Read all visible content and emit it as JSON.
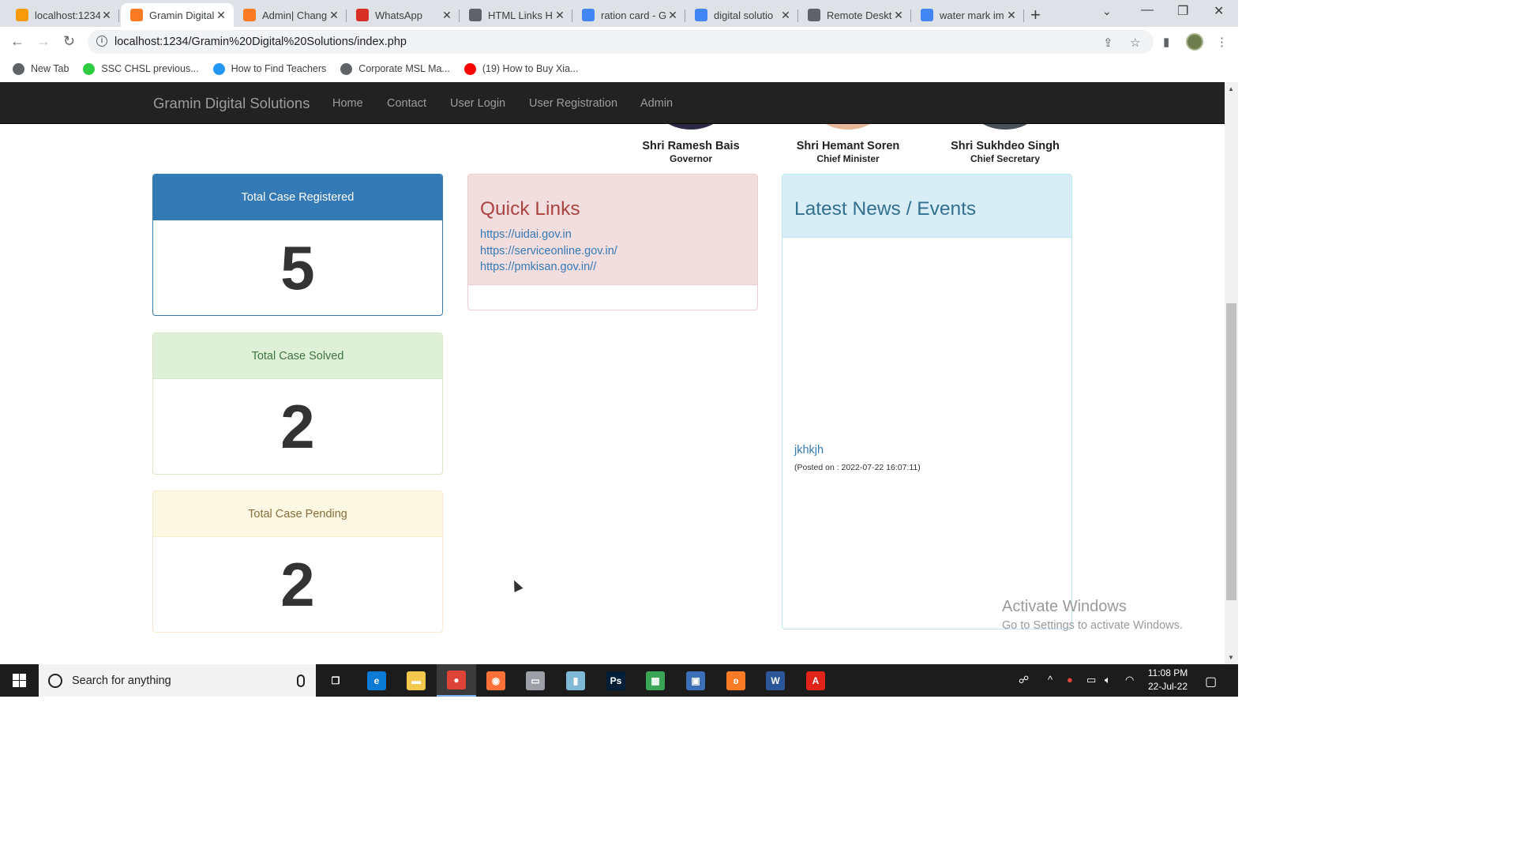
{
  "browser": {
    "tabs": [
      {
        "title": "localhost:1234",
        "favicon": "pma-icon",
        "color": "#f89c0e",
        "active": false
      },
      {
        "title": "Gramin Digital",
        "favicon": "xampp-icon",
        "color": "#fb7a24",
        "active": true
      },
      {
        "title": "Admin| Chang",
        "favicon": "xampp-icon",
        "color": "#fb7a24",
        "active": false
      },
      {
        "title": "WhatsApp",
        "favicon": "alert-icon",
        "color": "#d93025",
        "active": false
      },
      {
        "title": "HTML Links H",
        "favicon": "globe-icon",
        "color": "#5f6368",
        "active": false
      },
      {
        "title": "ration card - G",
        "favicon": "google-icon",
        "color": "#4285f4",
        "active": false
      },
      {
        "title": "digital solutio",
        "favicon": "google-icon",
        "color": "#4285f4",
        "active": false
      },
      {
        "title": "Remote Deskt",
        "favicon": "globe-icon",
        "color": "#5f6368",
        "active": false
      },
      {
        "title": "water mark im",
        "favicon": "google-icon",
        "color": "#4285f4",
        "active": false
      }
    ],
    "url": "localhost:1234/Gramin%20Digital%20Solutions/index.php",
    "bookmarks": [
      {
        "label": "New Tab",
        "icon": "globe-icon",
        "color": "#5f6368"
      },
      {
        "label": "SSC CHSL previous...",
        "icon": "q-icon",
        "color": "#2ecc40"
      },
      {
        "label": "How to Find Teachers",
        "icon": "b-icon",
        "color": "#2196f3"
      },
      {
        "label": "Corporate MSL Ma...",
        "icon": "globe-icon",
        "color": "#5f6368"
      },
      {
        "label": "(19) How to Buy Xia...",
        "icon": "youtube-icon",
        "color": "#ff0000"
      }
    ]
  },
  "site": {
    "brand": "Gramin Digital Solutions",
    "nav": [
      "Home",
      "Contact",
      "User Login",
      "User Registration",
      "Admin"
    ],
    "officials": [
      {
        "name": "Shri Ramesh Bais",
        "role": "Governor"
      },
      {
        "name": "Shri Hemant Soren",
        "role": "Chief Minister"
      },
      {
        "name": "Shri Sukhdeo Singh",
        "role": "Chief Secretary"
      }
    ],
    "stats": [
      {
        "label": "Total Case Registered",
        "value": "5"
      },
      {
        "label": "Total Case Solved",
        "value": "2"
      },
      {
        "label": "Total Case Pending",
        "value": "2"
      }
    ],
    "quick_links": {
      "title": "Quick Links",
      "links": [
        "https://uidai.gov.in",
        "https://serviceonline.gov.in/",
        "https://pmkisan.gov.in//"
      ]
    },
    "news": {
      "title": "Latest News / Events",
      "items": [
        {
          "title": "jkhkjh",
          "posted": "(Posted on : 2022-07-22 16:07:11)"
        }
      ]
    }
  },
  "watermark": {
    "line1": "Activate Windows",
    "line2": "Go to Settings to activate Windows."
  },
  "taskbar": {
    "search_placeholder": "Search for anything",
    "apps": [
      {
        "name": "task-view-icon",
        "glyph": "❐",
        "color": "#1c1c1c"
      },
      {
        "name": "edge-icon",
        "glyph": "e",
        "color": "#0a7ad4"
      },
      {
        "name": "file-explorer-icon",
        "glyph": "▬",
        "color": "#f2c94c"
      },
      {
        "name": "chrome-icon",
        "glyph": "●",
        "color": "#db4437"
      },
      {
        "name": "firefox-icon",
        "glyph": "◉",
        "color": "#ff7139"
      },
      {
        "name": "scanner-icon",
        "glyph": "▭",
        "color": "#9aa0a6"
      },
      {
        "name": "notepad-icon",
        "glyph": "▮",
        "color": "#7fb9d6"
      },
      {
        "name": "photoshop-icon",
        "glyph": "Ps",
        "color": "#001e36"
      },
      {
        "name": "spreadsheet-icon",
        "glyph": "▦",
        "color": "#3aa655"
      },
      {
        "name": "remote-desktop-icon",
        "glyph": "▣",
        "color": "#3d6fb6"
      },
      {
        "name": "xampp-icon",
        "glyph": "ʚ",
        "color": "#fb7a24"
      },
      {
        "name": "word-icon",
        "glyph": "W",
        "color": "#2b579a"
      },
      {
        "name": "acrobat-icon",
        "glyph": "A",
        "color": "#e2231a"
      }
    ],
    "time": "11:08 PM",
    "date": "22-Jul-22"
  }
}
